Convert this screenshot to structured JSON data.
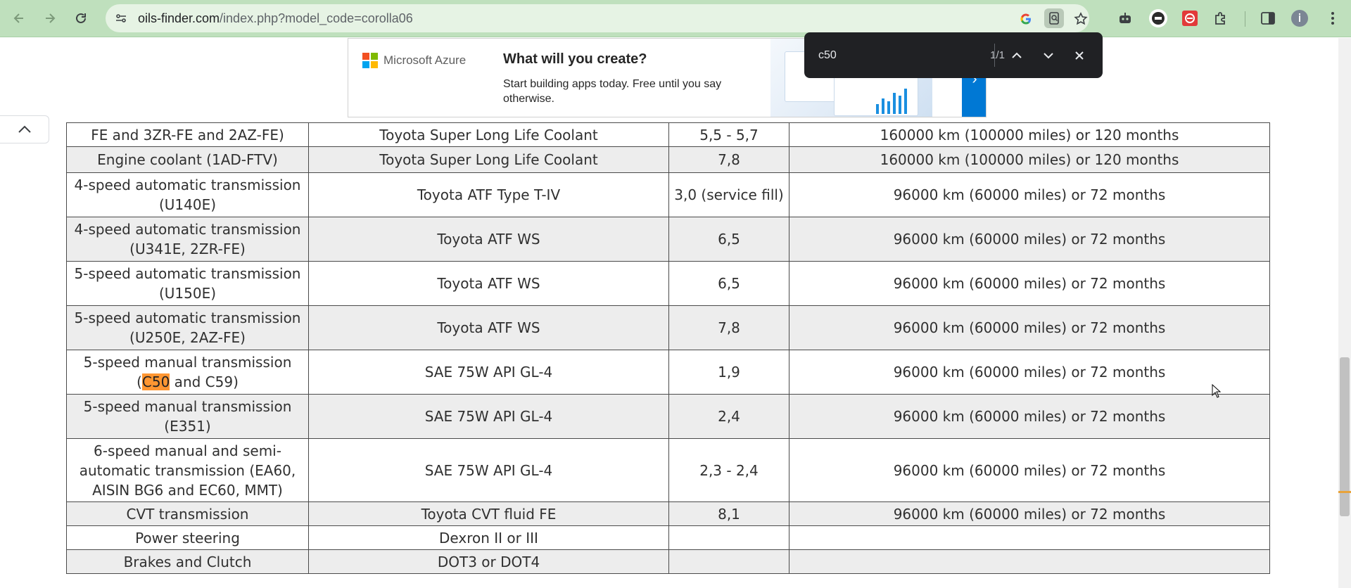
{
  "browser": {
    "url_host": "oils-finder.com",
    "url_path": "/index.php?model_code=corolla06"
  },
  "ad": {
    "brand": "Microsoft Azure",
    "headline": "What will you create?",
    "subtext": "Start building apps today. Free until you say otherwise.",
    "cta_glyph": "›"
  },
  "find": {
    "query": "c50",
    "count": "1/1"
  },
  "table": {
    "rows": [
      {
        "component": "FE and 3ZR-FE and 2AZ-FE)",
        "fluid": "Toyota Super Long Life Coolant",
        "capacity": "5,5 - 5,7",
        "interval": "160000 km (100000 miles) or 120 months",
        "shaded": false
      },
      {
        "component": "Engine coolant (1AD-FTV)",
        "fluid": "Toyota Super Long Life Coolant",
        "capacity": "7,8",
        "interval": "160000 km (100000 miles) or 120 months",
        "shaded": true
      },
      {
        "component": "4-speed automatic transmission (U140E)",
        "fluid": "Toyota ATF Type T-IV",
        "capacity": "3,0 (service fill)",
        "interval": "96000 km (60000 miles) or 72 months",
        "shaded": false
      },
      {
        "component": "4-speed automatic transmission (U341E, 2ZR-FE)",
        "fluid": "Toyota ATF WS",
        "capacity": "6,5",
        "interval": "96000 km (60000 miles) or 72 months",
        "shaded": true
      },
      {
        "component": "5-speed automatic transmission (U150E)",
        "fluid": "Toyota ATF WS",
        "capacity": "6,5",
        "interval": "96000 km (60000 miles) or 72 months",
        "shaded": false
      },
      {
        "component": "5-speed automatic transmission (U250E, 2AZ-FE)",
        "fluid": "Toyota ATF WS",
        "capacity": "7,8",
        "interval": "96000 km (60000 miles) or 72 months",
        "shaded": true
      },
      {
        "component_before": "5-speed manual transmission (",
        "component_match": "C50",
        "component_after": " and C59)",
        "fluid": "SAE 75W API GL-4",
        "capacity": "1,9",
        "interval": "96000 km (60000 miles) or 72 months",
        "shaded": false
      },
      {
        "component": "5-speed manual transmission (E351)",
        "fluid": "SAE 75W API GL-4",
        "capacity": "2,4",
        "interval": "96000 km (60000 miles) or 72 months",
        "shaded": true
      },
      {
        "component": "6-speed manual and semi-automatic transmission (EA60, AISIN BG6 and EC60, MMT)",
        "fluid": "SAE 75W API GL-4",
        "capacity": "2,3 - 2,4",
        "interval": "96000 km (60000 miles) or 72 months",
        "shaded": false
      },
      {
        "component": "CVT transmission",
        "fluid": "Toyota CVT fluid FE",
        "capacity": "8,1",
        "interval": "96000 km (60000 miles) or 72 months",
        "shaded": true
      },
      {
        "component": "Power steering",
        "fluid": "Dexron II or III",
        "capacity": "",
        "interval": "",
        "shaded": false
      },
      {
        "component": "Brakes and Clutch",
        "fluid": "DOT3 or DOT4",
        "capacity": "",
        "interval": "",
        "shaded": true
      }
    ]
  }
}
